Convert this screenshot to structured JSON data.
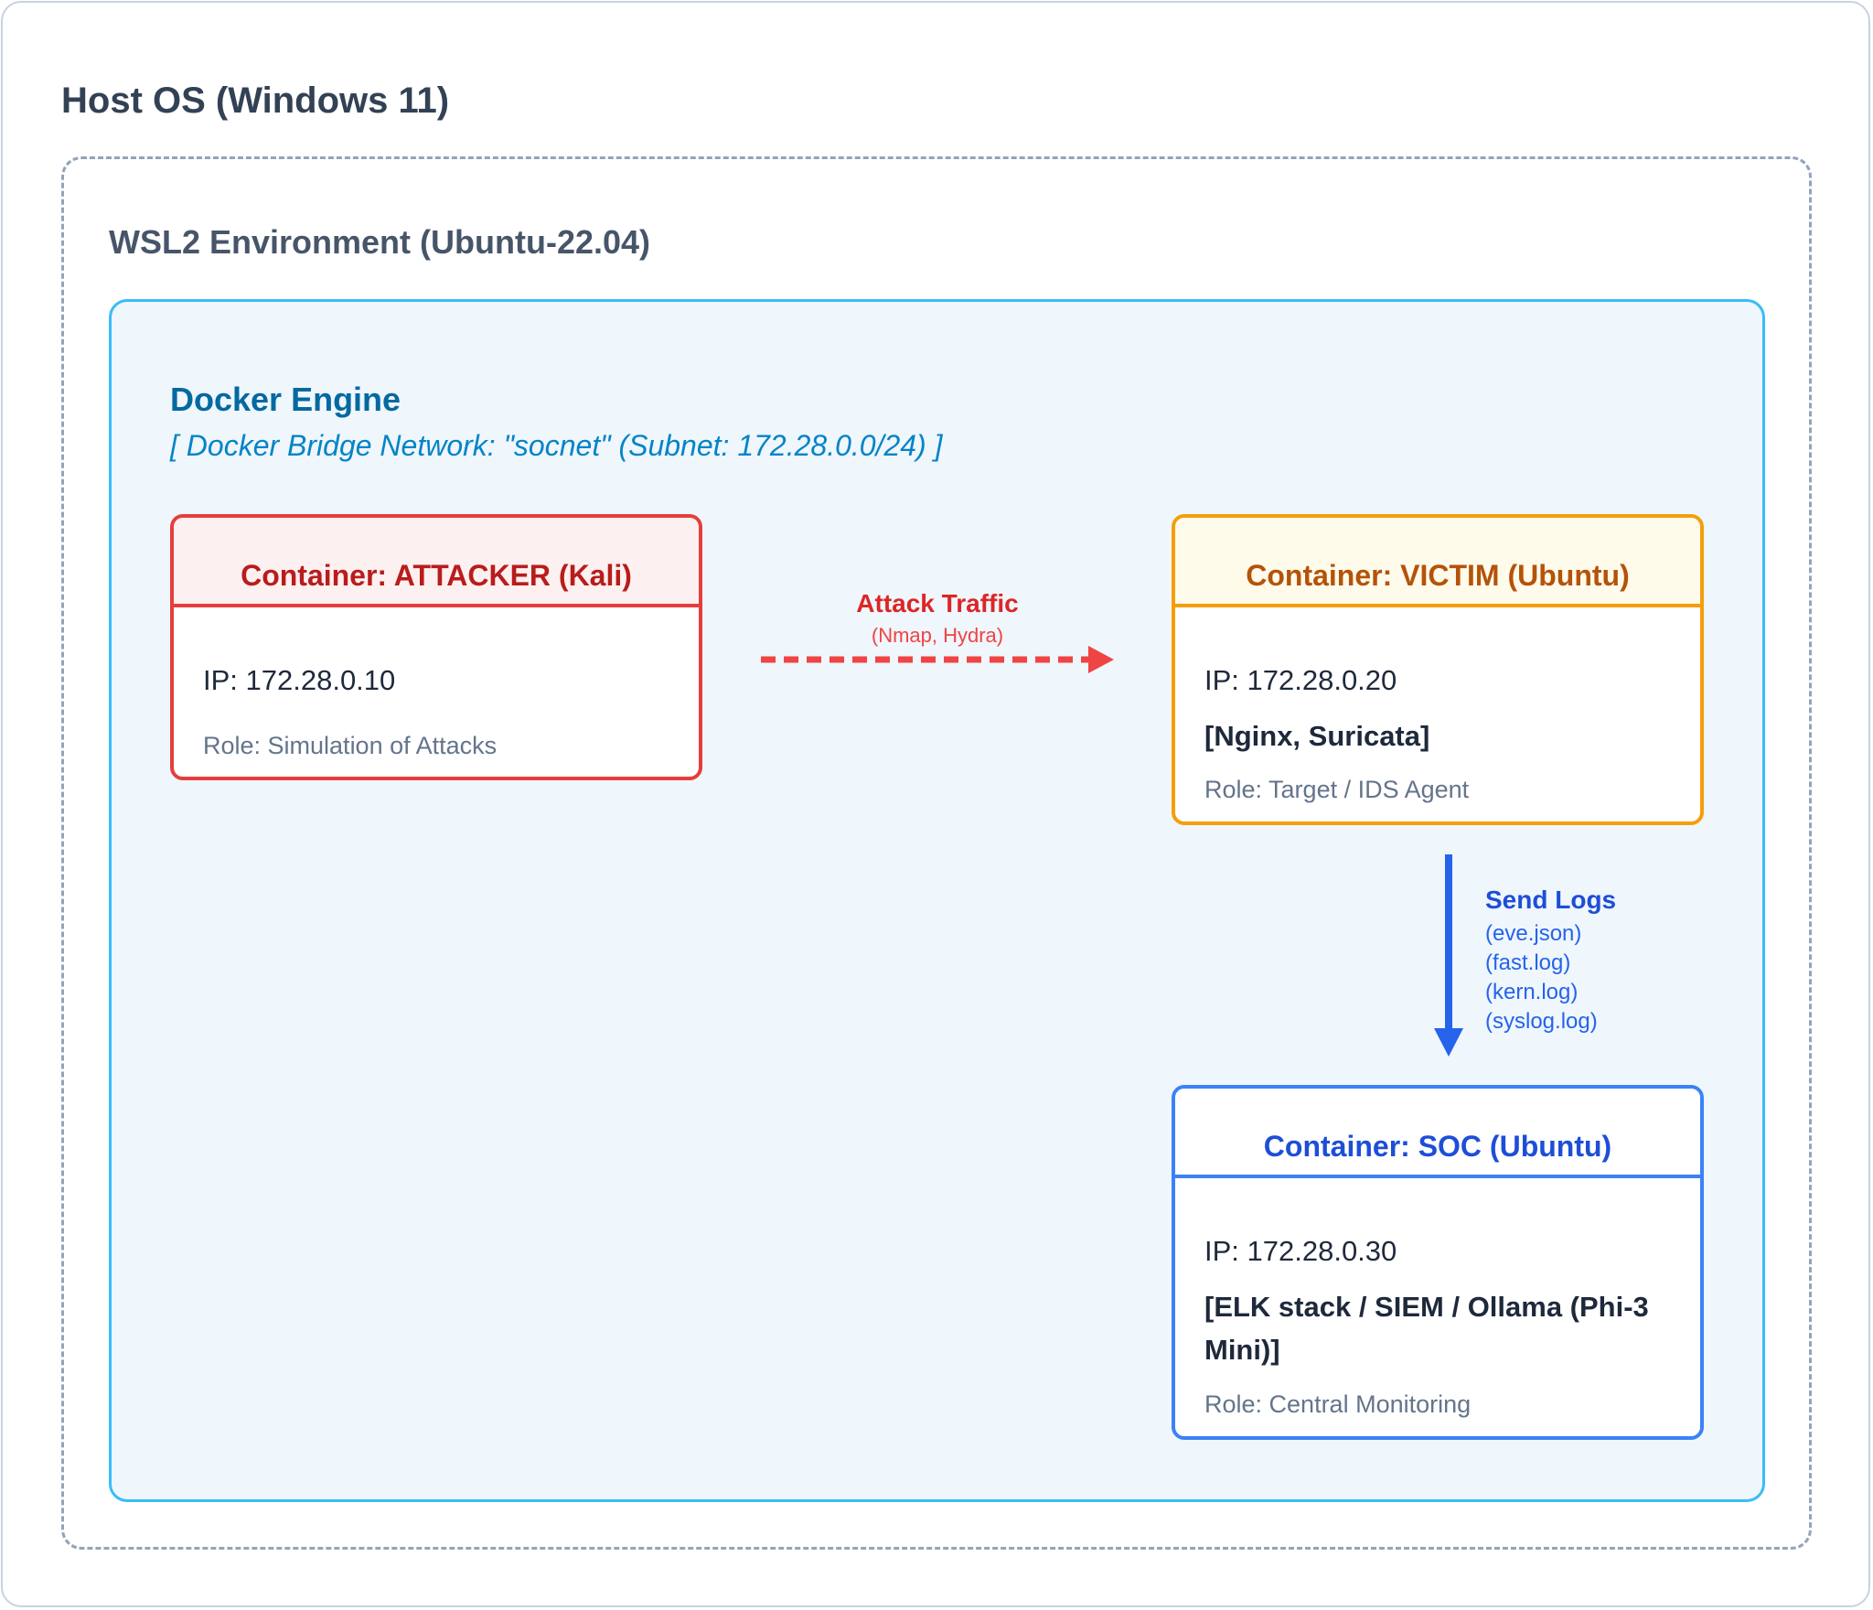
{
  "host": {
    "title": "Host OS (Windows 11)"
  },
  "wsl": {
    "title": "WSL2 Environment (Ubuntu-22.04)"
  },
  "docker": {
    "title": "Docker Engine",
    "network": "[ Docker Bridge Network: \"socnet\" (Subnet: 172.28.0.0/24) ]"
  },
  "containers": {
    "attacker": {
      "title": "Container: ATTACKER (Kali)",
      "ip": "IP: 172.28.0.10",
      "role": "Role: Simulation of Attacks"
    },
    "victim": {
      "title": "Container: VICTIM (Ubuntu)",
      "ip": "IP: 172.28.0.20",
      "tools": "[Nginx, Suricata]",
      "role": "Role: Target / IDS Agent"
    },
    "soc": {
      "title": "Container: SOC (Ubuntu)",
      "ip": "IP: 172.28.0.30",
      "tools": "[ELK stack / SIEM / Ollama (Phi-3 Mini)]",
      "role": "Role: Central Monitoring"
    }
  },
  "edges": {
    "attack": {
      "label": "Attack Traffic",
      "sub": "(Nmap, Hydra)"
    },
    "logs": {
      "label": "Send Logs",
      "files": [
        "(eve.json)",
        "(fast.log)",
        "(kern.log)",
        "(syslog.log)"
      ]
    }
  },
  "colors": {
    "attacker": "#e53e3e",
    "victim": "#f59e0b",
    "soc": "#3b82f6",
    "docker": "#38bdf8",
    "wsl": "#94a3b8"
  }
}
